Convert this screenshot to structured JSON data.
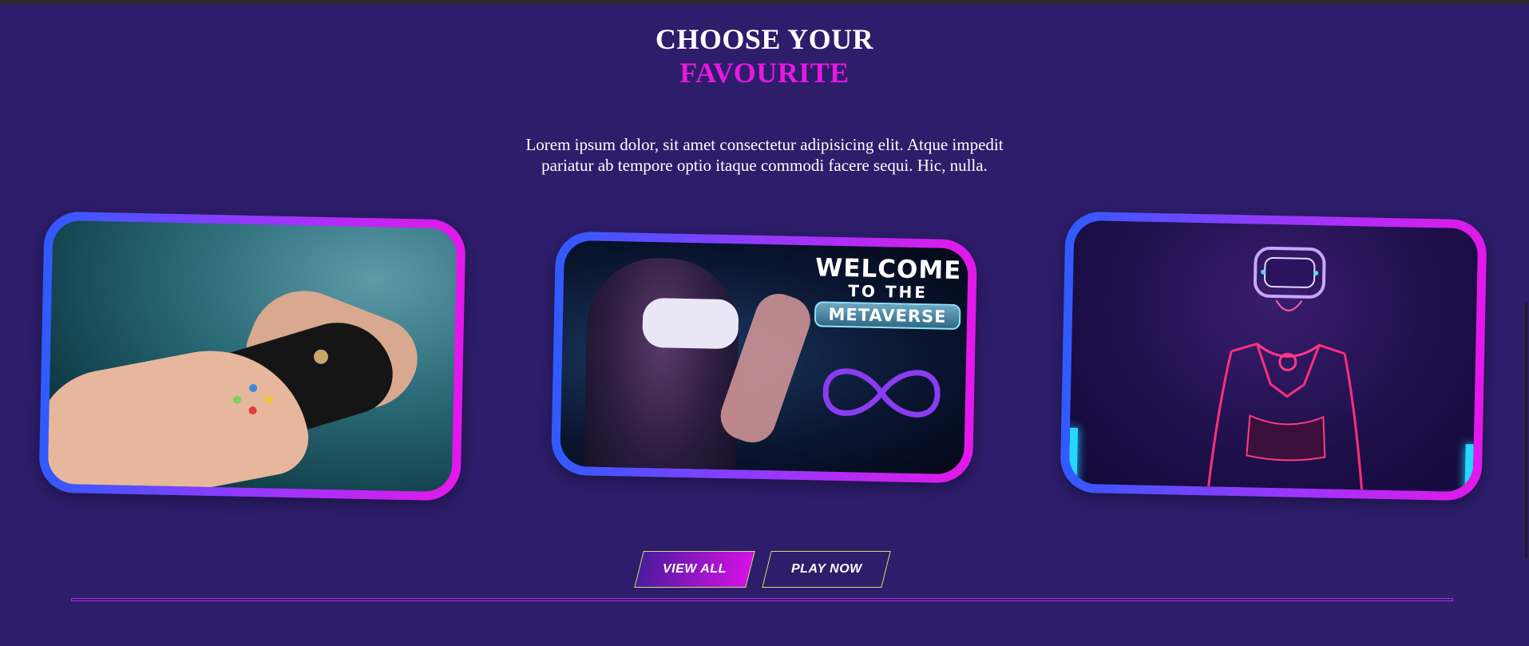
{
  "section": {
    "title_line1": "CHOOSE YOUR",
    "title_line2": "FAVOURITE",
    "description": "Lorem ipsum dolor, sit amet consectetur adipisicing elit. Atque impedit pariatur ab tempore optio itaque commodi facere sequi. Hic, nulla."
  },
  "cards": [
    {
      "image": "gamer-hands-controller"
    },
    {
      "image": "metaverse-vr-woman",
      "overlay": {
        "line1": "WELCOME",
        "line2": "TO THE",
        "line3": "METAVERSE"
      }
    },
    {
      "image": "neon-vr-android"
    }
  ],
  "buttons": {
    "view_all": "VIEW ALL",
    "play_now": "PLAY NOW"
  },
  "colors": {
    "background": "#2d1d6b",
    "accent_magenta": "#e619e0",
    "gradient_start": "#2f5bff",
    "gradient_end": "#e418ea",
    "button_border": "#c4e86a"
  }
}
